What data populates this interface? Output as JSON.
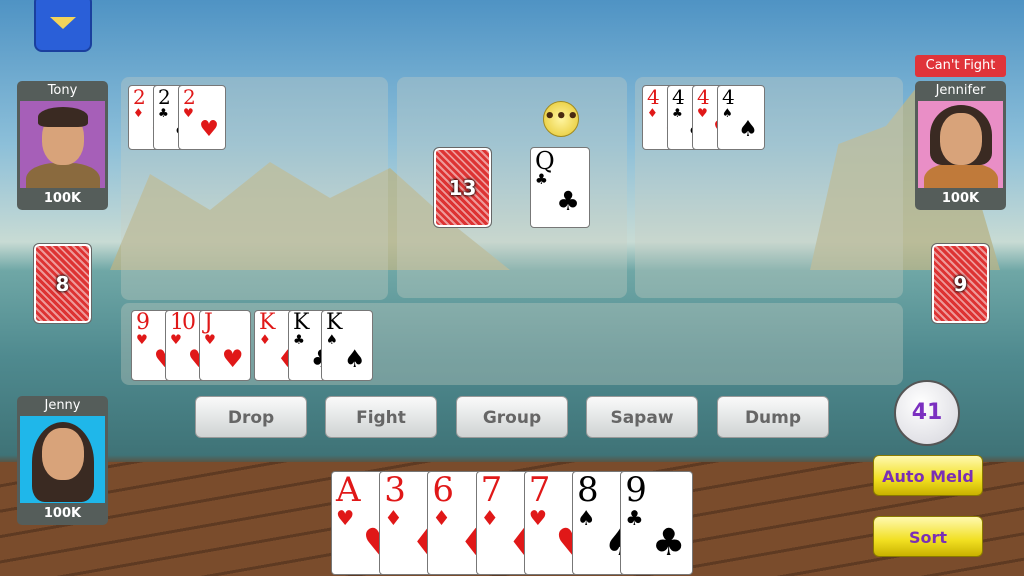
{
  "menu": {
    "icon": "dropdown-triangle-icon"
  },
  "players": {
    "tony": {
      "name": "Tony",
      "money": "100K",
      "avatar_bg": "#a65fb8",
      "card_count": "8"
    },
    "jennifer": {
      "name": "Jennifer",
      "money": "100K",
      "avatar_bg": "#e98ec6",
      "card_count": "9",
      "status": "Can't Fight"
    },
    "jenny": {
      "name": "Jenny",
      "money": "100K",
      "avatar_bg": "#1fb7ea"
    }
  },
  "table": {
    "deck_count": "13",
    "discard": {
      "rank": "Q",
      "suit": "♣"
    },
    "waiting_icon": "ellipsis-icon",
    "waiting_text": "•••",
    "tony_melds": [
      {
        "rank": "2",
        "suit": "♦"
      },
      {
        "rank": "2",
        "suit": "♣"
      },
      {
        "rank": "2",
        "suit": "♥"
      }
    ],
    "jennifer_melds": [
      {
        "rank": "4",
        "suit": "♦"
      },
      {
        "rank": "4",
        "suit": "♣"
      },
      {
        "rank": "4",
        "suit": "♥"
      },
      {
        "rank": "4",
        "suit": "♠"
      }
    ],
    "my_melds": [
      {
        "rank": "9",
        "suit": "♥"
      },
      {
        "rank": "10",
        "suit": "♥"
      },
      {
        "rank": "J",
        "suit": "♥"
      },
      {
        "rank": "K",
        "suit": "♦"
      },
      {
        "rank": "K",
        "suit": "♣"
      },
      {
        "rank": "K",
        "suit": "♠"
      }
    ]
  },
  "actions": [
    "Drop",
    "Fight",
    "Group",
    "Sapaw",
    "Dump"
  ],
  "turn_timer": "41",
  "auto_meld_label": "Auto Meld",
  "sort_label": "Sort",
  "hand": [
    {
      "rank": "A",
      "suit": "♥"
    },
    {
      "rank": "3",
      "suit": "♦"
    },
    {
      "rank": "6",
      "suit": "♦"
    },
    {
      "rank": "7",
      "suit": "♦"
    },
    {
      "rank": "7",
      "suit": "♥"
    },
    {
      "rank": "8",
      "suit": "♠"
    },
    {
      "rank": "9",
      "suit": "♣"
    }
  ],
  "colors": {
    "red_suit": "#e01818",
    "black_suit": "#000000",
    "button_text": "#7a2fb5",
    "cant_fight": "#e0343a"
  }
}
